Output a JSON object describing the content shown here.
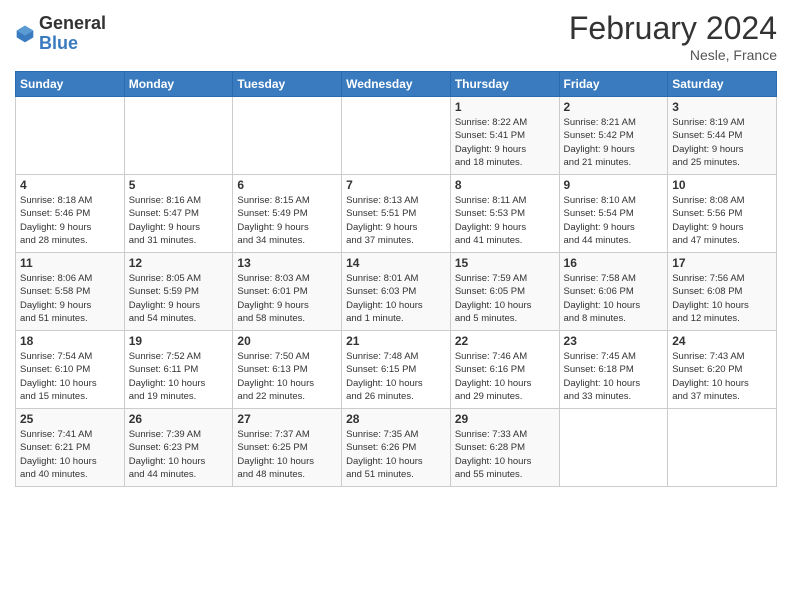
{
  "logo": {
    "general": "General",
    "blue": "Blue"
  },
  "title": "February 2024",
  "location": "Nesle, France",
  "days_of_week": [
    "Sunday",
    "Monday",
    "Tuesday",
    "Wednesday",
    "Thursday",
    "Friday",
    "Saturday"
  ],
  "weeks": [
    [
      {
        "day": "",
        "info": ""
      },
      {
        "day": "",
        "info": ""
      },
      {
        "day": "",
        "info": ""
      },
      {
        "day": "",
        "info": ""
      },
      {
        "day": "1",
        "info": "Sunrise: 8:22 AM\nSunset: 5:41 PM\nDaylight: 9 hours\nand 18 minutes."
      },
      {
        "day": "2",
        "info": "Sunrise: 8:21 AM\nSunset: 5:42 PM\nDaylight: 9 hours\nand 21 minutes."
      },
      {
        "day": "3",
        "info": "Sunrise: 8:19 AM\nSunset: 5:44 PM\nDaylight: 9 hours\nand 25 minutes."
      }
    ],
    [
      {
        "day": "4",
        "info": "Sunrise: 8:18 AM\nSunset: 5:46 PM\nDaylight: 9 hours\nand 28 minutes."
      },
      {
        "day": "5",
        "info": "Sunrise: 8:16 AM\nSunset: 5:47 PM\nDaylight: 9 hours\nand 31 minutes."
      },
      {
        "day": "6",
        "info": "Sunrise: 8:15 AM\nSunset: 5:49 PM\nDaylight: 9 hours\nand 34 minutes."
      },
      {
        "day": "7",
        "info": "Sunrise: 8:13 AM\nSunset: 5:51 PM\nDaylight: 9 hours\nand 37 minutes."
      },
      {
        "day": "8",
        "info": "Sunrise: 8:11 AM\nSunset: 5:53 PM\nDaylight: 9 hours\nand 41 minutes."
      },
      {
        "day": "9",
        "info": "Sunrise: 8:10 AM\nSunset: 5:54 PM\nDaylight: 9 hours\nand 44 minutes."
      },
      {
        "day": "10",
        "info": "Sunrise: 8:08 AM\nSunset: 5:56 PM\nDaylight: 9 hours\nand 47 minutes."
      }
    ],
    [
      {
        "day": "11",
        "info": "Sunrise: 8:06 AM\nSunset: 5:58 PM\nDaylight: 9 hours\nand 51 minutes."
      },
      {
        "day": "12",
        "info": "Sunrise: 8:05 AM\nSunset: 5:59 PM\nDaylight: 9 hours\nand 54 minutes."
      },
      {
        "day": "13",
        "info": "Sunrise: 8:03 AM\nSunset: 6:01 PM\nDaylight: 9 hours\nand 58 minutes."
      },
      {
        "day": "14",
        "info": "Sunrise: 8:01 AM\nSunset: 6:03 PM\nDaylight: 10 hours\nand 1 minute."
      },
      {
        "day": "15",
        "info": "Sunrise: 7:59 AM\nSunset: 6:05 PM\nDaylight: 10 hours\nand 5 minutes."
      },
      {
        "day": "16",
        "info": "Sunrise: 7:58 AM\nSunset: 6:06 PM\nDaylight: 10 hours\nand 8 minutes."
      },
      {
        "day": "17",
        "info": "Sunrise: 7:56 AM\nSunset: 6:08 PM\nDaylight: 10 hours\nand 12 minutes."
      }
    ],
    [
      {
        "day": "18",
        "info": "Sunrise: 7:54 AM\nSunset: 6:10 PM\nDaylight: 10 hours\nand 15 minutes."
      },
      {
        "day": "19",
        "info": "Sunrise: 7:52 AM\nSunset: 6:11 PM\nDaylight: 10 hours\nand 19 minutes."
      },
      {
        "day": "20",
        "info": "Sunrise: 7:50 AM\nSunset: 6:13 PM\nDaylight: 10 hours\nand 22 minutes."
      },
      {
        "day": "21",
        "info": "Sunrise: 7:48 AM\nSunset: 6:15 PM\nDaylight: 10 hours\nand 26 minutes."
      },
      {
        "day": "22",
        "info": "Sunrise: 7:46 AM\nSunset: 6:16 PM\nDaylight: 10 hours\nand 29 minutes."
      },
      {
        "day": "23",
        "info": "Sunrise: 7:45 AM\nSunset: 6:18 PM\nDaylight: 10 hours\nand 33 minutes."
      },
      {
        "day": "24",
        "info": "Sunrise: 7:43 AM\nSunset: 6:20 PM\nDaylight: 10 hours\nand 37 minutes."
      }
    ],
    [
      {
        "day": "25",
        "info": "Sunrise: 7:41 AM\nSunset: 6:21 PM\nDaylight: 10 hours\nand 40 minutes."
      },
      {
        "day": "26",
        "info": "Sunrise: 7:39 AM\nSunset: 6:23 PM\nDaylight: 10 hours\nand 44 minutes."
      },
      {
        "day": "27",
        "info": "Sunrise: 7:37 AM\nSunset: 6:25 PM\nDaylight: 10 hours\nand 48 minutes."
      },
      {
        "day": "28",
        "info": "Sunrise: 7:35 AM\nSunset: 6:26 PM\nDaylight: 10 hours\nand 51 minutes."
      },
      {
        "day": "29",
        "info": "Sunrise: 7:33 AM\nSunset: 6:28 PM\nDaylight: 10 hours\nand 55 minutes."
      },
      {
        "day": "",
        "info": ""
      },
      {
        "day": "",
        "info": ""
      }
    ]
  ]
}
